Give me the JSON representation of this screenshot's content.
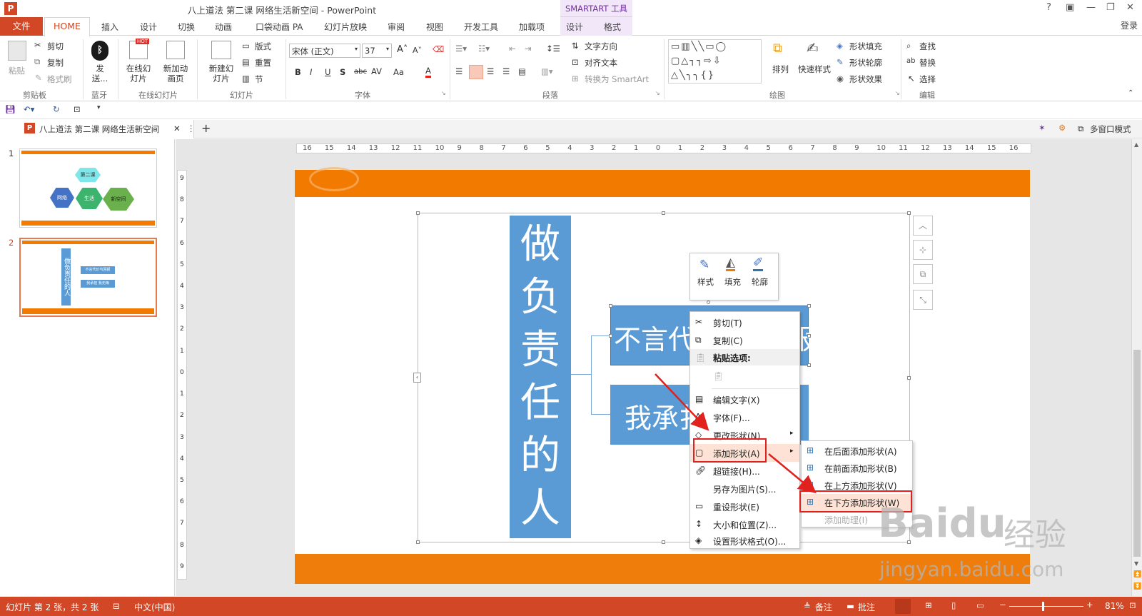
{
  "window": {
    "title": "八上道法 第二课 网络生活新空间 - PowerPoint",
    "smartart_tools": "SMARTART 工具",
    "help": "?",
    "login": "登录"
  },
  "tabs": {
    "file": "文件",
    "home": "HOME",
    "items": [
      "插入",
      "设计",
      "切换",
      "动画",
      "口袋动画 PA",
      "幻灯片放映",
      "审阅",
      "视图",
      "开发工具",
      "加载项"
    ],
    "context": [
      "设计",
      "格式"
    ]
  },
  "ribbon": {
    "clipboard": {
      "paste": "粘贴",
      "cut": "剪切",
      "copy": "复制",
      "format_painter": "格式刷",
      "label": "剪贴板"
    },
    "bluetooth": {
      "send": "发送...",
      "label": "蓝牙"
    },
    "online": {
      "online_slide": "在线幻灯片",
      "new_anim": "新加动画页",
      "hot": "HOT",
      "label": "在线幻灯片"
    },
    "slides": {
      "new_slide": "新建幻灯片",
      "layout": "版式",
      "reset": "重置",
      "section": "节",
      "label": "幻灯片"
    },
    "font": {
      "name": "宋体 (正文)",
      "size": "37",
      "label": "字体",
      "aa": "Aa"
    },
    "paragraph": {
      "text_direction": "文字方向",
      "align_text": "对齐文本",
      "convert": "转换为 SmartArt",
      "label": "段落"
    },
    "drawing": {
      "arrange": "排列",
      "quick_styles": "快速样式",
      "shape_fill": "形状填充",
      "shape_outline": "形状轮廓",
      "shape_effects": "形状效果",
      "label": "绘图"
    },
    "editing": {
      "find": "查找",
      "replace": "替换",
      "select": "选择",
      "label": "编辑"
    }
  },
  "doc_tab": {
    "title": "八上道法 第二课 网络生活新空间",
    "multi_window": "多窗口模式"
  },
  "thumbnails": [
    {
      "number": "1",
      "top": "第二课",
      "left": "网络",
      "mid": "生活",
      "right": "新空间"
    },
    {
      "number": "2",
      "main": "做负责任的人",
      "line1": "不言代价与回报",
      "line2": "我承担 我无悔"
    }
  ],
  "slide": {
    "vertical_title": [
      "做",
      "负",
      "责",
      "任",
      "的",
      "人"
    ],
    "box1_text": "不言代",
    "box1_end": "报",
    "box2_text": "我承扌"
  },
  "ruler": {
    "h_labels": [
      "16",
      "15",
      "14",
      "13",
      "12",
      "11",
      "10",
      "9",
      "8",
      "7",
      "6",
      "5",
      "4",
      "3",
      "2",
      "1",
      "0",
      "1",
      "2",
      "3",
      "4",
      "5",
      "6",
      "7",
      "8",
      "9",
      "10",
      "11",
      "12",
      "13",
      "14",
      "15",
      "16"
    ],
    "v_labels": [
      "9",
      "8",
      "7",
      "6",
      "5",
      "4",
      "3",
      "2",
      "1",
      "0",
      "1",
      "2",
      "3",
      "4",
      "5",
      "6",
      "7",
      "8",
      "9"
    ]
  },
  "mini_toolbar": {
    "style": "样式",
    "fill": "填充",
    "outline": "轮廓"
  },
  "context_menu": {
    "items": [
      {
        "label": "剪切(T)",
        "icon": "scissors-icon"
      },
      {
        "label": "复制(C)",
        "icon": "copy-icon"
      },
      {
        "label": "粘贴选项:",
        "icon": "paste-icon"
      },
      {
        "label": "编辑文字(X)",
        "icon": "edit-text-icon"
      },
      {
        "label": "字体(F)...",
        "icon": "font-icon"
      },
      {
        "label": "更改形状(N)",
        "icon": "change-shape-icon"
      },
      {
        "label": "添加形状(A)",
        "icon": "add-shape-icon"
      },
      {
        "label": "超链接(H)...",
        "icon": "hyperlink-icon"
      },
      {
        "label": "另存为图片(S)...",
        "icon": ""
      },
      {
        "label": "重设形状(E)",
        "icon": "reset-shape-icon"
      },
      {
        "label": "大小和位置(Z)...",
        "icon": "size-position-icon"
      },
      {
        "label": "设置形状格式(O)...",
        "icon": "format-shape-icon"
      }
    ]
  },
  "submenu": {
    "items": [
      {
        "label": "在后面添加形状(A)",
        "enabled": true
      },
      {
        "label": "在前面添加形状(B)",
        "enabled": true
      },
      {
        "label": "在上方添加形状(V)",
        "enabled": true
      },
      {
        "label": "在下方添加形状(W)",
        "enabled": true
      },
      {
        "label": "添加助理(I)",
        "enabled": false
      }
    ]
  },
  "status": {
    "slide": "幻灯片 第 2 张，共 2 张",
    "lang": "中文(中国)",
    "notes": "备注",
    "comments": "批注",
    "zoom": "81%"
  },
  "watermark": {
    "brand": "Baidu",
    "cn": "经验",
    "url": "jingyan.baidu.com"
  },
  "colors": {
    "accent": "#d24726",
    "smartart_blue": "#5b9bd5",
    "slide_orange": "#f37a00",
    "highlight_red": "#e0211d",
    "purple": "#7030a0"
  }
}
